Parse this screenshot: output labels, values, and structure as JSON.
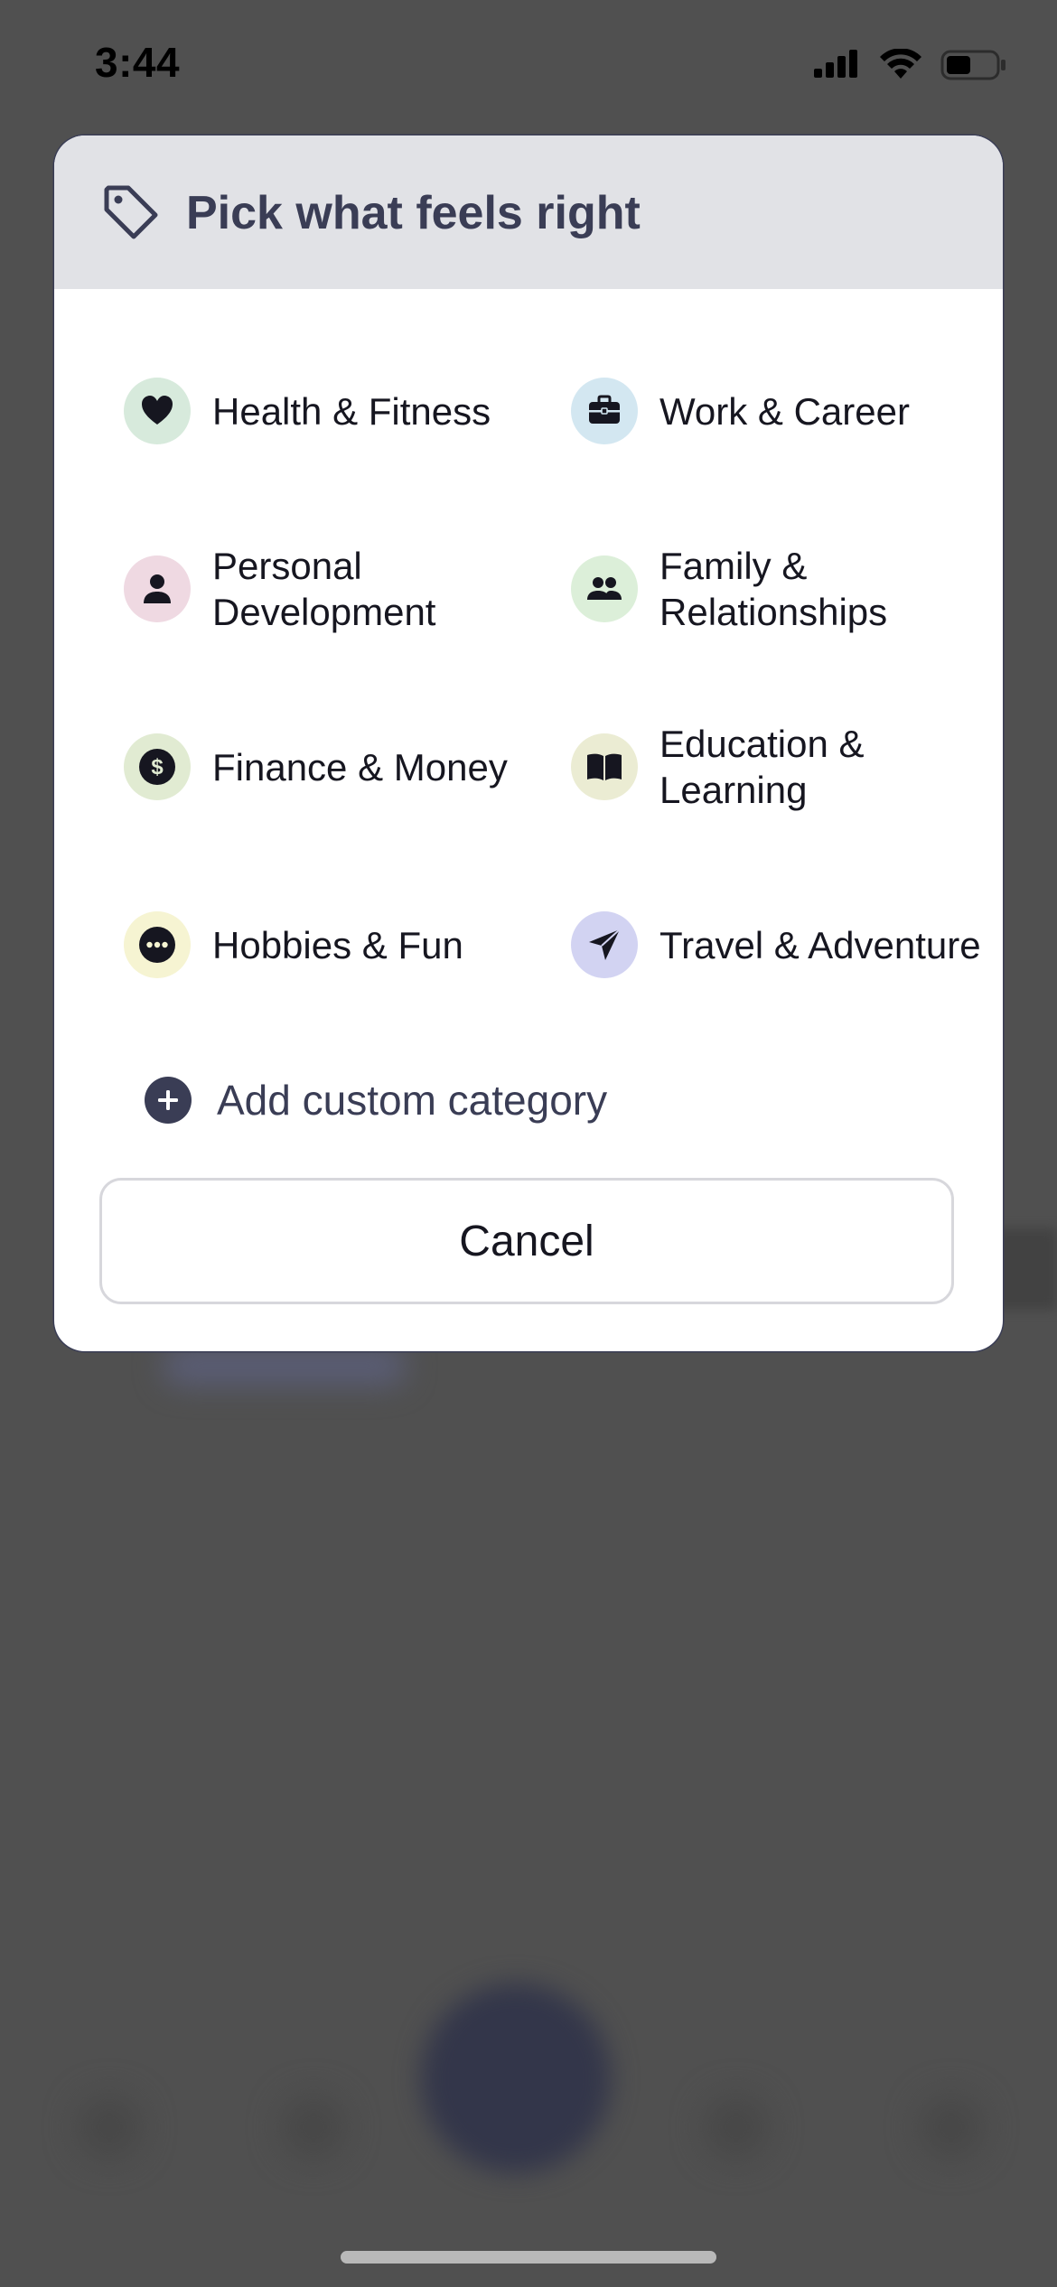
{
  "status_bar": {
    "time": "3:44"
  },
  "modal": {
    "title": "Pick what feels right",
    "header_icon": "tag-icon",
    "categories": [
      {
        "label": "Health & Fitness",
        "icon": "heart-icon",
        "bg": "#d7eadc"
      },
      {
        "label": "Work & Career",
        "icon": "briefcase-icon",
        "bg": "#d3e7f1"
      },
      {
        "label": "Personal Development",
        "icon": "person-icon",
        "bg": "#efd9e2"
      },
      {
        "label": "Family & Relationships",
        "icon": "people-icon",
        "bg": "#dcefd9"
      },
      {
        "label": "Finance & Money",
        "icon": "dollar-icon",
        "bg": "#e1ebd2"
      },
      {
        "label": "Education & Learning",
        "icon": "book-icon",
        "bg": "#ebecd3"
      },
      {
        "label": "Hobbies & Fun",
        "icon": "ellipsis-icon",
        "bg": "#f6f4d2"
      },
      {
        "label": "Travel & Adventure",
        "icon": "paper-plane-icon",
        "bg": "#d2d3f2"
      }
    ],
    "add_custom_label": "Add custom category",
    "cancel_label": "Cancel"
  },
  "colors": {
    "accent": "#3a3d55",
    "header_bg": "#e1e2e6",
    "overlay": "#505050"
  }
}
